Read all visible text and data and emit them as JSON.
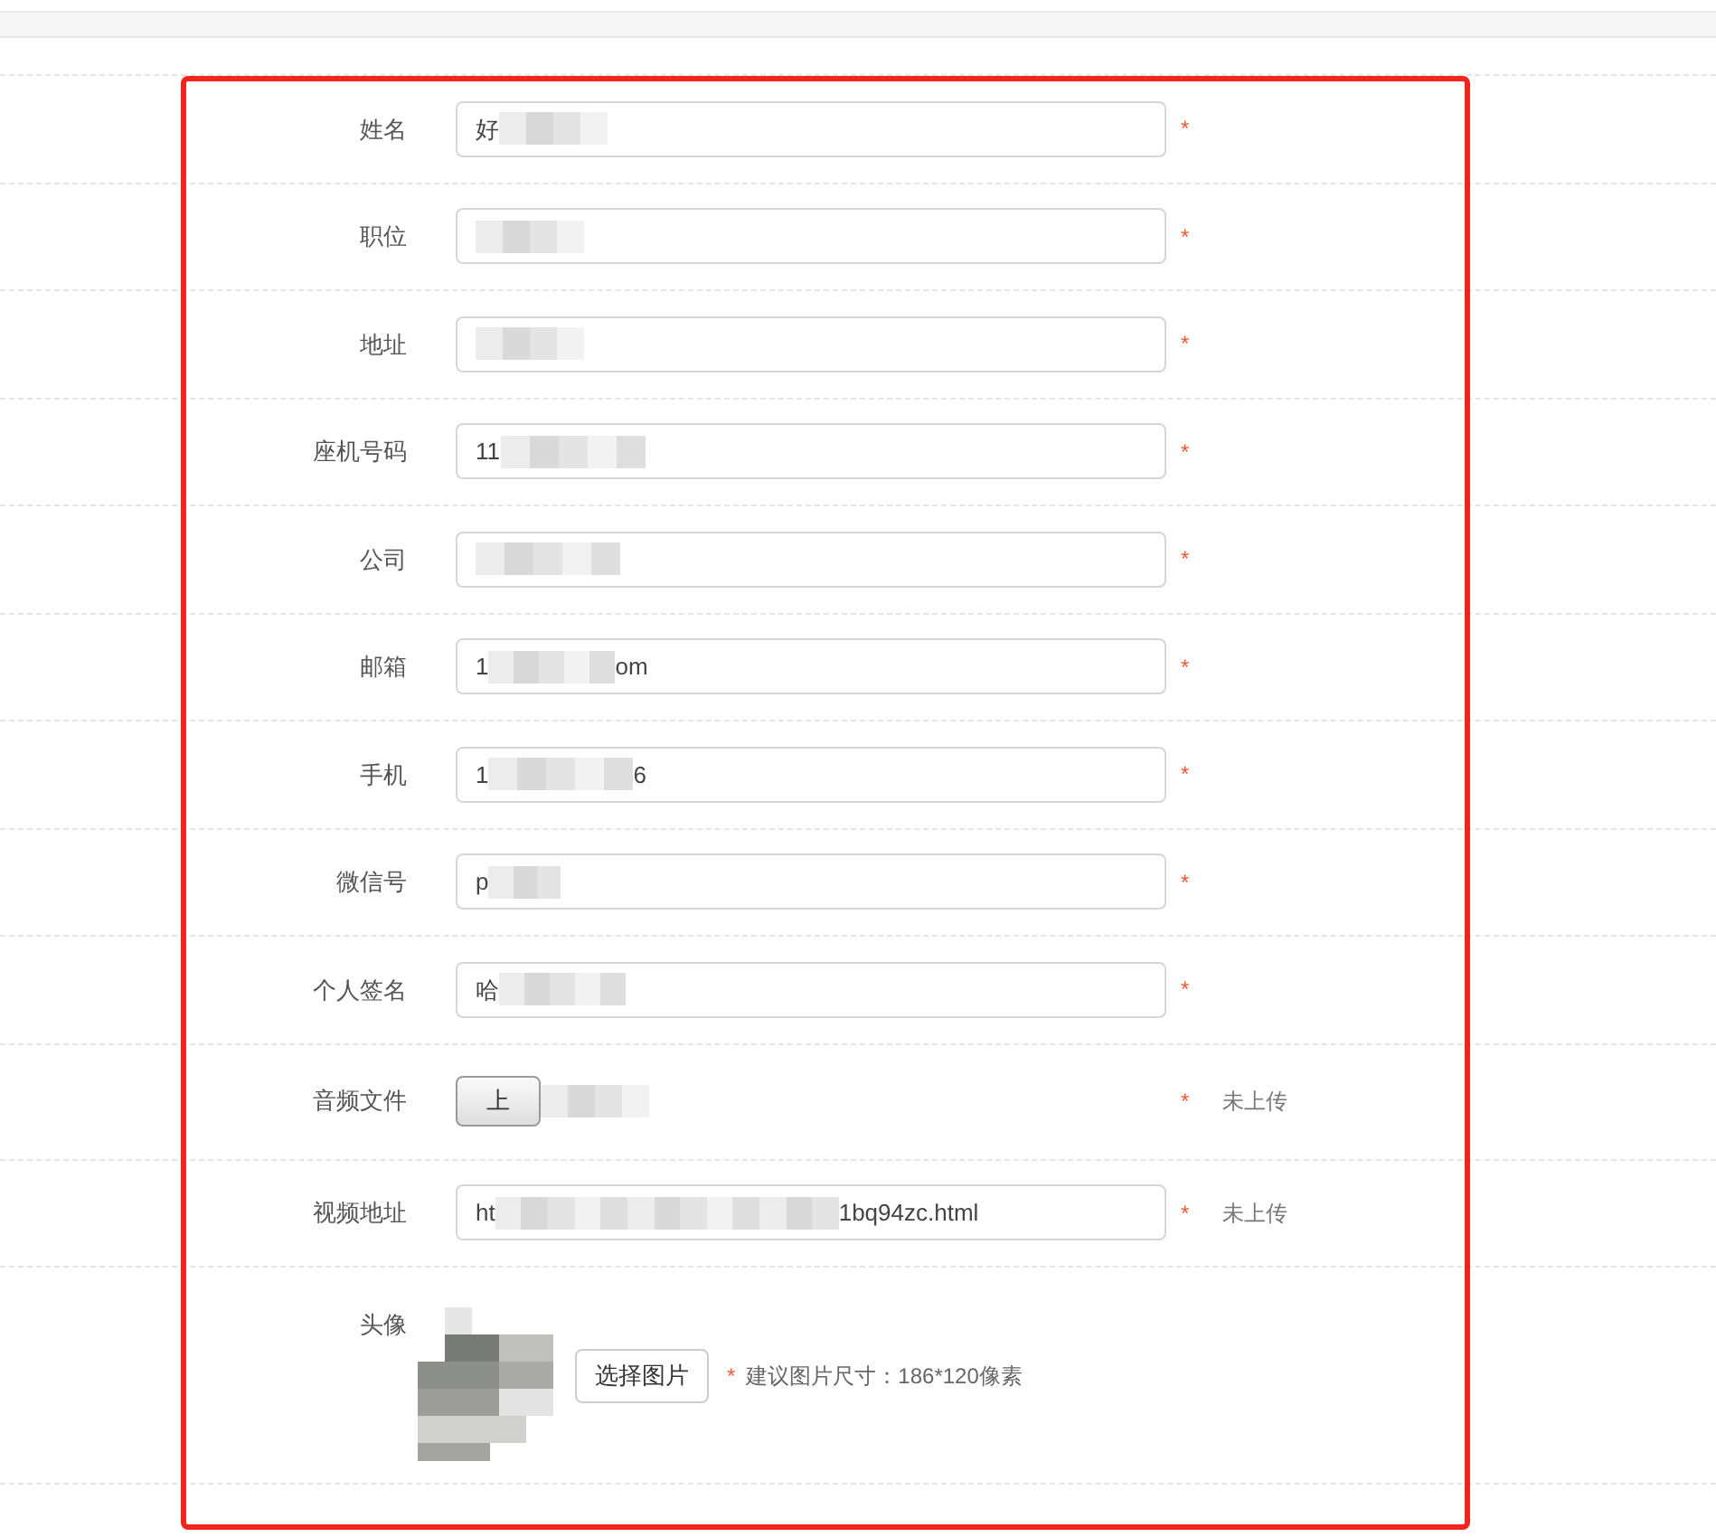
{
  "fields": [
    {
      "kind": "text",
      "label": "姓名",
      "value": "好",
      "mark": "*"
    },
    {
      "kind": "text",
      "label": "职位",
      "mark": "*"
    },
    {
      "kind": "text",
      "label": "地址",
      "mark": "*"
    },
    {
      "kind": "text",
      "label": "座机号码",
      "value": "11",
      "mark": "*"
    },
    {
      "kind": "text",
      "label": "公司",
      "mark": "*"
    },
    {
      "kind": "text",
      "label": "邮箱",
      "value": "1",
      "value_end": "om",
      "mark": "*"
    },
    {
      "kind": "text",
      "label": "手机",
      "value": "1",
      "value_end": "6",
      "mark": "*"
    },
    {
      "kind": "text",
      "label": "微信号",
      "value": "p",
      "mark": "*"
    },
    {
      "kind": "text",
      "label": "个人签名",
      "value": "哈",
      "mark": "*"
    },
    {
      "kind": "file",
      "label": "音频文件",
      "button": "上",
      "mark": "*",
      "status": "未上传"
    },
    {
      "kind": "text",
      "label": "视频地址",
      "value": "ht",
      "value_end": "1bq94zc.html",
      "mark": "*",
      "status": "未上传"
    },
    {
      "label": "头像",
      "button": "选择图片",
      "mark": "*",
      "hint": "建议图片尺寸：186*120像素"
    }
  ]
}
